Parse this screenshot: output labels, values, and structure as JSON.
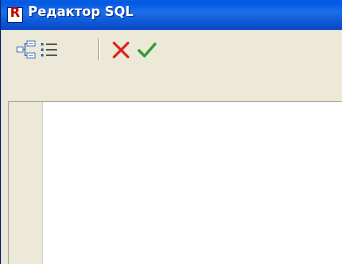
{
  "window": {
    "title": "Редактор SQL",
    "app_icon_letter": "R"
  },
  "toolbar": {
    "buttons": [
      {
        "name": "query-tree-button",
        "icon": "tree-structure-icon"
      },
      {
        "name": "list-view-button",
        "icon": "list-icon"
      },
      {
        "name": "cancel-button",
        "icon": "red-cross-icon",
        "color": "#e02020"
      },
      {
        "name": "apply-button",
        "icon": "green-checkmark-icon",
        "color": "#2e9b2e"
      }
    ]
  },
  "editor": {
    "content": ""
  },
  "colors": {
    "titlebar": "#0a50d0",
    "window_bg": "#ece9d8",
    "editor_bg": "#ffffff",
    "cancel": "#e02020",
    "apply": "#2e9b2e"
  }
}
